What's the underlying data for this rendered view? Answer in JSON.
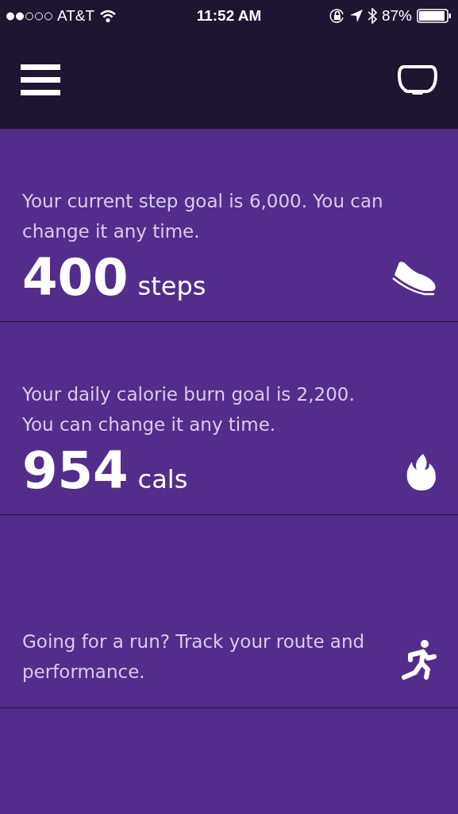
{
  "status_bar": {
    "carrier": "AT&T",
    "time": "11:52 AM",
    "battery": "87%"
  },
  "cards": [
    {
      "kind": "steps",
      "text": "Your current step goal is 6,000. You can change it any time.",
      "value": "400",
      "unit": "steps"
    },
    {
      "kind": "calories",
      "text": "Your daily calorie burn goal is 2,200. You can change it any time.",
      "value": "954",
      "unit": "cals"
    },
    {
      "kind": "run",
      "text": "Going for a run? Track your route and performance."
    }
  ]
}
